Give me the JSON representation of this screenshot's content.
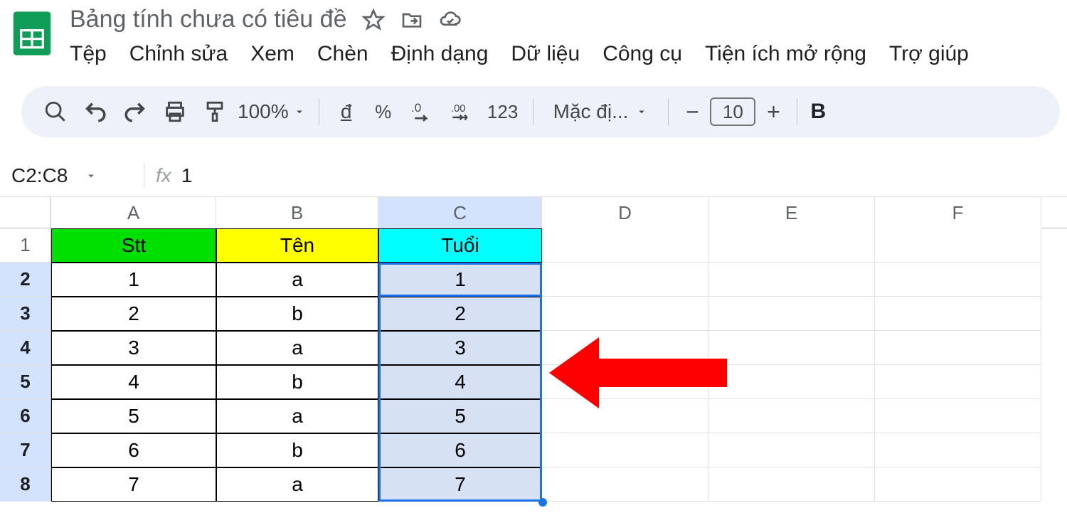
{
  "title": "Bảng tính chưa có tiêu đề",
  "menus": {
    "file": "Tệp",
    "edit": "Chỉnh sửa",
    "view": "Xem",
    "insert": "Chèn",
    "format": "Định dạng",
    "data": "Dữ liệu",
    "tools": "Công cụ",
    "extensions": "Tiện ích mở rộng",
    "help": "Trợ giúp"
  },
  "toolbar": {
    "zoom": "100%",
    "currency": "đ",
    "percent": "%",
    "dec_dec": ".0",
    "dec_inc": ".00",
    "fmt123": "123",
    "font": "Mặc đị...",
    "font_size": "10",
    "bold": "B"
  },
  "namebox": "C2:C8",
  "fx_label": "fx",
  "fx_value": "1",
  "columns": [
    "A",
    "B",
    "C",
    "D",
    "E",
    "F"
  ],
  "rows": [
    "1",
    "2",
    "3",
    "4",
    "5",
    "6",
    "7",
    "8"
  ],
  "headers": {
    "A": "Stt",
    "B": "Tên",
    "C": "Tuổi"
  },
  "data": [
    {
      "A": "1",
      "B": "a",
      "C": "1"
    },
    {
      "A": "2",
      "B": "b",
      "C": "2"
    },
    {
      "A": "3",
      "B": "a",
      "C": "3"
    },
    {
      "A": "4",
      "B": "b",
      "C": "4"
    },
    {
      "A": "5",
      "B": "a",
      "C": "5"
    },
    {
      "A": "6",
      "B": "b",
      "C": "6"
    },
    {
      "A": "7",
      "B": "a",
      "C": "7"
    }
  ],
  "header_colors": {
    "A": "#00e000",
    "B": "#ffff00",
    "C": "#00ffff"
  },
  "selected_column": "C",
  "selected_rows": [
    2,
    3,
    4,
    5,
    6,
    7,
    8
  ],
  "active_cell": "C2"
}
